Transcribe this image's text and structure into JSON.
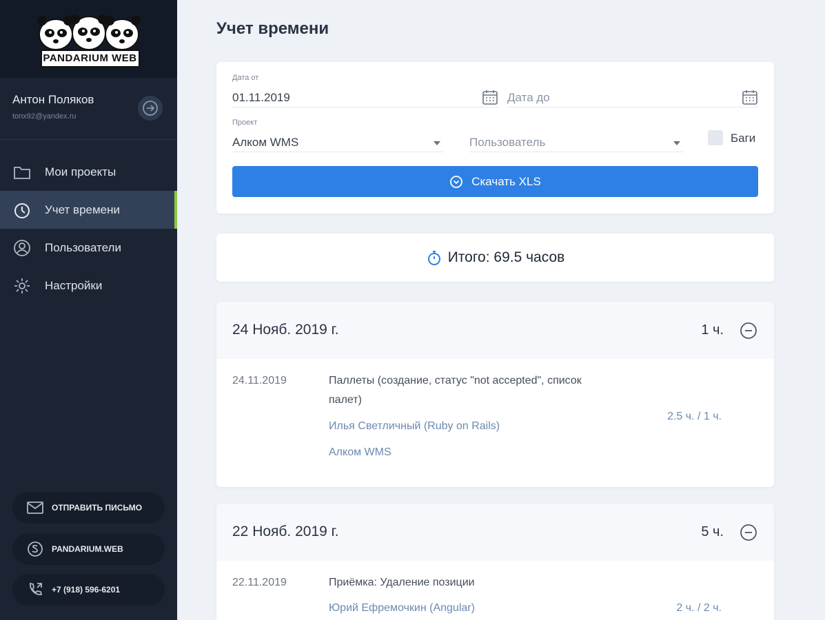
{
  "sidebar": {
    "logo_text": "PANDARIUM WEB",
    "user": {
      "name": "Антон Поляков",
      "email": "tonx92@yandex.ru"
    },
    "nav": [
      {
        "label": "Мои проекты",
        "icon": "folder-icon",
        "active": false
      },
      {
        "label": "Учет времени",
        "icon": "timer-icon",
        "active": true
      },
      {
        "label": "Пользователи",
        "icon": "user-icon",
        "active": false
      },
      {
        "label": "Настройки",
        "icon": "gear-icon",
        "active": false
      }
    ],
    "contacts": [
      {
        "label": "ОТПРАВИТЬ ПИСЬМО",
        "icon": "mail-icon"
      },
      {
        "label": "PANDARIUM.WEB",
        "icon": "skype-icon"
      },
      {
        "label": "+7 (918) 596-6201",
        "icon": "phone-icon"
      }
    ]
  },
  "page": {
    "title": "Учет времени"
  },
  "filters": {
    "date_from": {
      "label": "Дата от",
      "value": "01.11.2019"
    },
    "date_to": {
      "placeholder": "Дата до"
    },
    "project": {
      "label": "Проект",
      "value": "Алком WMS"
    },
    "user": {
      "placeholder": "Пользователь"
    },
    "bugs_label": "Баги",
    "bugs_checked": false,
    "download_label": "Скачать XLS"
  },
  "total": {
    "text": "Итого: 69.5 часов"
  },
  "days": [
    {
      "title": "24 Нояб. 2019 г.",
      "hours": "1 ч.",
      "entries": [
        {
          "date": "24.11.2019",
          "title": "Паллеты (создание, статус \"not accepted\", список палет)",
          "user": "Илья Светличный (Ruby on Rails)",
          "project": "Алком WMS",
          "ratio": "2.5 ч. / 1 ч."
        }
      ]
    },
    {
      "title": "22 Нояб. 2019 г.",
      "hours": "5 ч.",
      "entries": [
        {
          "date": "22.11.2019",
          "title": "Приёмка: Удаление позиции",
          "user": "Юрий Ефремочкин (Angular)",
          "ratio": "2 ч. / 2 ч."
        }
      ]
    }
  ],
  "colors": {
    "sidebar": "#1c2434",
    "accent": "#2f80e4",
    "active_marker": "#8cc63f",
    "link": "#6d89b0"
  }
}
